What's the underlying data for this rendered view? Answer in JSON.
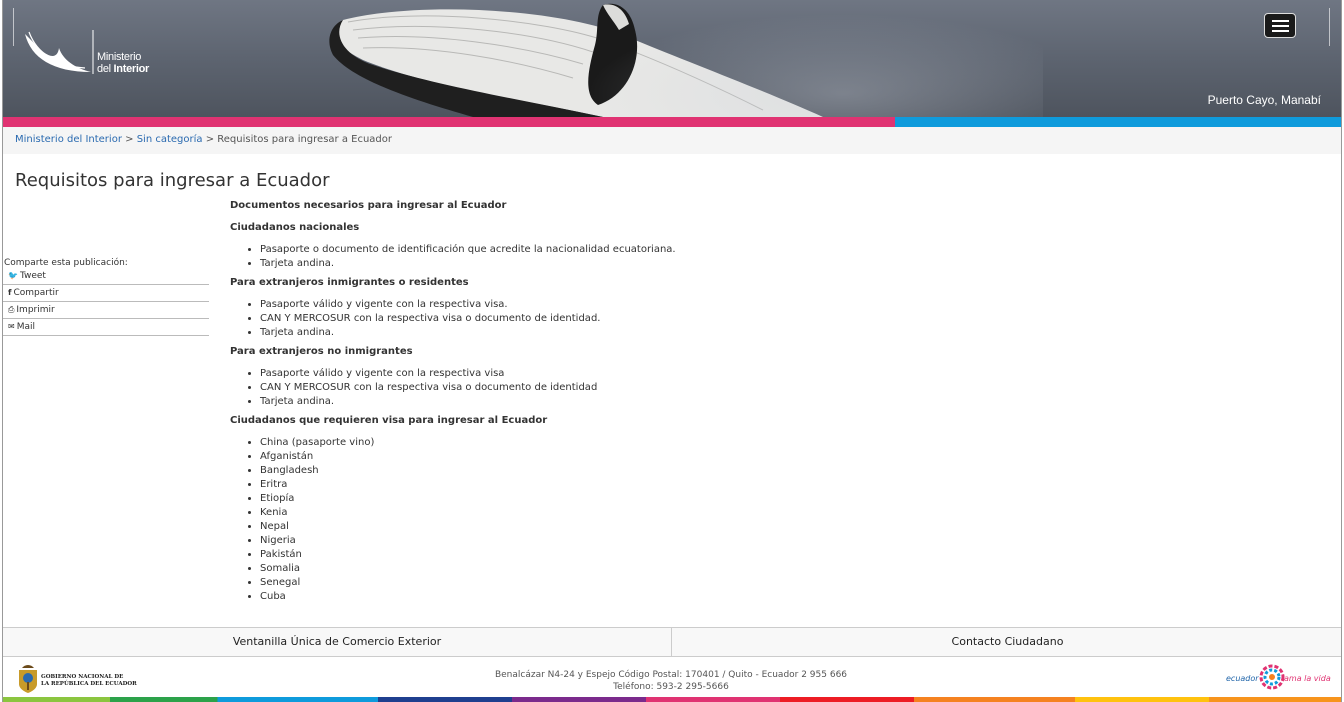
{
  "header": {
    "logo_line1": "Ministerio",
    "logo_line2_prefix": "del ",
    "logo_line2_bold": "Interior",
    "location": "Puerto Cayo, Manabí",
    "menu_icon": "hamburger-icon"
  },
  "breadcrumb": {
    "item1": "Ministerio del Interior",
    "sep1": " > ",
    "item2": "Sin categoría",
    "sep2": " > ",
    "current": "Requisitos para ingresar a Ecuador"
  },
  "page": {
    "title": "Requisitos para ingresar a Ecuador"
  },
  "share": {
    "label": "Comparte esta publicación:",
    "items": [
      {
        "icon": "twitter-icon",
        "label": "Tweet"
      },
      {
        "icon": "facebook-icon",
        "label": "Compartir"
      },
      {
        "icon": "print-icon",
        "label": "Imprimir"
      },
      {
        "icon": "mail-icon",
        "label": "Mail"
      }
    ]
  },
  "content": {
    "heading_main": "Documentos necesarios para ingresar al Ecuador",
    "sections": [
      {
        "heading": "Ciudadanos nacionales",
        "items": [
          "Pasaporte o documento de identificación que acredite la nacionalidad ecuatoriana.",
          "Tarjeta andina."
        ]
      },
      {
        "heading": "Para extranjeros inmigrantes o residentes",
        "items": [
          "Pasaporte válido y vigente con la respectiva visa.",
          "CAN Y MERCOSUR con la respectiva visa o documento de identidad.",
          "Tarjeta andina."
        ]
      },
      {
        "heading": "Para extranjeros no inmigrantes",
        "items": [
          "Pasaporte válido y vigente con la respectiva visa",
          "CAN Y MERCOSUR con la respectiva visa o documento de identidad",
          "Tarjeta andina."
        ]
      },
      {
        "heading": "Ciudadanos que requieren visa para ingresar al Ecuador",
        "items": [
          "China (pasaporte vino)",
          "Afganistán",
          "Bangladesh",
          "Eritra",
          "Etiopía",
          "Kenia",
          "Nepal",
          "Nigeria",
          "Pakistán",
          "Somalia",
          "Senegal",
          "Cuba"
        ]
      }
    ]
  },
  "footer": {
    "link1": "Ventanilla Única de Comercio Exterior",
    "link2": "Contacto Ciudadano",
    "gov_line1": "GOBIERNO NACIONAL DE",
    "gov_line2": "LA REPÚBLICA DEL ECUADOR",
    "address_line1": "Benalcázar N4-24 y Espejo Código Postal: 170401 / Quito - Ecuador 2 955 666",
    "address_line2": "Teléfono: 593-2 295-5666",
    "brand_left": "ecuador",
    "brand_right": "ama la vida"
  },
  "colors": {
    "pink": "#e03372",
    "blue": "#0f9bdc",
    "link": "#2a6ab0"
  }
}
